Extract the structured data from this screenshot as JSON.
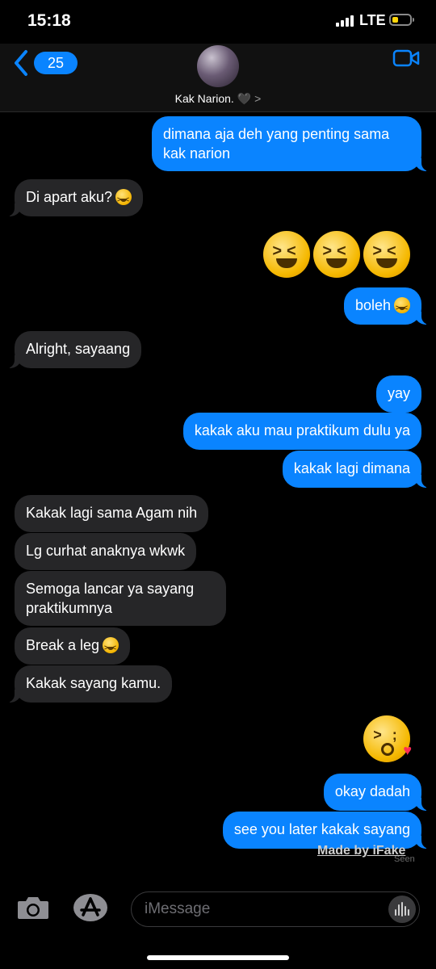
{
  "status_bar": {
    "time": "15:18",
    "network": "LTE"
  },
  "header": {
    "back_count": "25",
    "contact_name": "Kak Narion. 🖤",
    "contact_chevron": ">"
  },
  "messages": [
    {
      "side": "sent",
      "text": "dimana aja deh yang penting sama"
    },
    {
      "side": "sent",
      "text": "kak narion"
    },
    {
      "side": "received",
      "text": "Di apart aku?"
    },
    {
      "side": "sent",
      "type": "emoji",
      "text": "😆😆😆"
    },
    {
      "side": "sent",
      "text": "boleh"
    },
    {
      "side": "received",
      "text": "Alright, sayaang"
    },
    {
      "side": "sent",
      "text": "yay"
    },
    {
      "side": "sent",
      "text": "kakak aku mau praktikum dulu ya"
    },
    {
      "side": "sent",
      "text": "kakak lagi dimana"
    },
    {
      "side": "received",
      "text": "Kakak lagi sama Agam nih"
    },
    {
      "side": "received",
      "text": "Lg curhat anaknya wkwk"
    },
    {
      "side": "received",
      "text": "Semoga lancar ya sayang"
    },
    {
      "side": "received",
      "text": "praktikumnya"
    },
    {
      "side": "received",
      "text": "Break a leg"
    },
    {
      "side": "received",
      "text": "Kakak sayang kamu."
    },
    {
      "side": "sent",
      "type": "emoji",
      "text": "😘"
    },
    {
      "side": "sent",
      "text": "okay dadah"
    },
    {
      "side": "sent",
      "text": "see you later kakak sayang"
    }
  ],
  "watermark": "Made by iFake",
  "seen_label": "Seen",
  "input": {
    "placeholder": "iMessage"
  },
  "colors": {
    "sent_bubble": "#0a84ff",
    "received_bubble": "#262628",
    "background": "#000000"
  },
  "icons": [
    "back-chevron-icon",
    "facetime-video-icon",
    "camera-icon",
    "app-store-icon",
    "voice-waveform-icon"
  ]
}
